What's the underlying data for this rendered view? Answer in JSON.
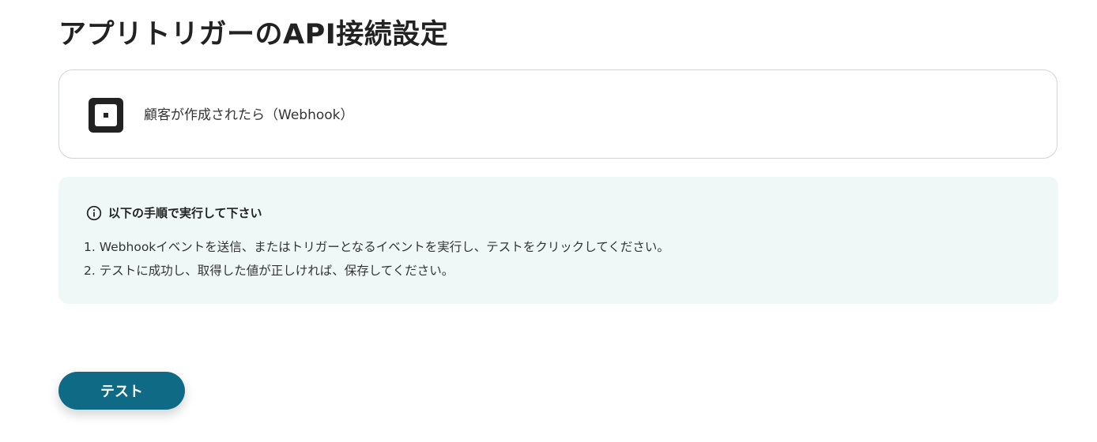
{
  "page": {
    "title": "アプリトリガーのAPI接続設定"
  },
  "trigger": {
    "app_icon": "square-logo-icon",
    "label": "顧客が作成されたら（Webhook）"
  },
  "instructions": {
    "icon": "info-icon",
    "heading": "以下の手順で実行して下さい",
    "steps": [
      "1. Webhookイベントを送信、またはトリガーとなるイベントを実行し、テストをクリックしてください。",
      "2. テストに成功し、取得した値が正しければ、保存してください。"
    ]
  },
  "actions": {
    "test_label": "テスト"
  },
  "colors": {
    "panel_background": "#eff8f7",
    "primary_button": "#0f6a86",
    "card_border": "#cfd3d8",
    "text": "#222222"
  }
}
